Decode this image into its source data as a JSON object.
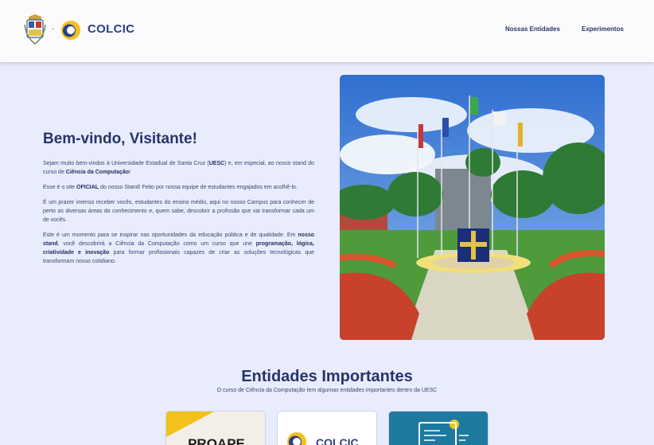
{
  "header": {
    "brand_name": "COLCIC",
    "separator": "-",
    "nav": [
      {
        "label": "Nossas Entidades"
      },
      {
        "label": "Experimentos"
      }
    ]
  },
  "hero": {
    "title": "Bem-vindo, Visitante!",
    "paragraphs": [
      [
        {
          "t": "Sejam muito bem-vindos à Universidade Estadual de Santa Cruz ("
        },
        {
          "t": "UESC",
          "b": true
        },
        {
          "t": ") e, em especial, ao nosso stand do curso de "
        },
        {
          "t": "Ciência da Computação",
          "b": true
        },
        {
          "t": "!"
        }
      ],
      [
        {
          "t": "Esse é o site "
        },
        {
          "t": "OFICIAL",
          "b": true
        },
        {
          "t": " do nosso Stand! Feito por nossa equipe de estudantes engajados em acolhê-lo."
        }
      ],
      [
        {
          "t": "É um prazer imenso receber vocês, estudantes do ensino médio, aqui no nosso Campus para conhecer de perto as diversas áreas do conhecimento e, quem sabe, descobrir a profissão que vai transformar cada um de vocês."
        }
      ],
      [
        {
          "t": "Este é um momento para se inspirar nas oportunidades da educação pública e de qualidade. Em "
        },
        {
          "t": "nosso stand",
          "b": true
        },
        {
          "t": ", você descobrirá a Ciência da Computação como um curso que une "
        },
        {
          "t": "programação, lógica, criatividade e inovação",
          "b": true
        },
        {
          "t": " para formar profissionais capazes de criar as soluções tecnológicas que transformam nosso cotidiano."
        }
      ]
    ]
  },
  "entities": {
    "title": "Entidades Importantes",
    "subtitle": "O curso de Ciência da Computação tem algumas entidades importantes dentro da UESC",
    "cards": [
      {
        "name": "proape",
        "logo_text": "PROAPE",
        "accent": "#f2c21b"
      },
      {
        "name": "colcic",
        "logo_text": "COLCIC",
        "accent": "#2b3f85"
      },
      {
        "name": "computing",
        "accent": "#1d7a9e"
      }
    ]
  },
  "colors": {
    "background": "#e9ecfc",
    "header_bg": "#fbfbfe",
    "title": "#27346b",
    "brand_blue": "#2b3f85",
    "brand_yellow": "#f2c21b"
  },
  "icons": {
    "university_crest": "uesc-crest-icon",
    "colcic_logo": "colcic-logo-icon"
  }
}
